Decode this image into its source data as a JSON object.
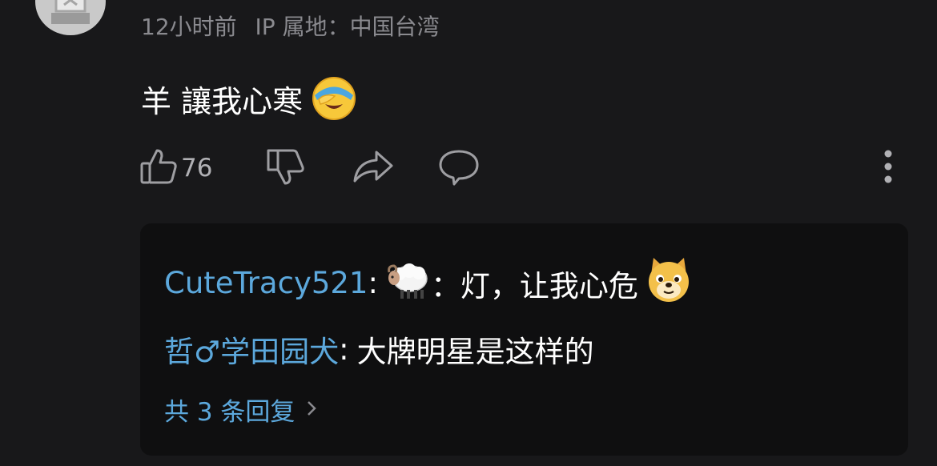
{
  "comment": {
    "time": "12小时前",
    "ip_location": "IP 属地：中国台湾",
    "text": "羊 讓我心寒",
    "like_count": "76",
    "icons": {
      "like": "thumbs-up-icon",
      "dislike": "thumbs-down-icon",
      "share": "share-icon",
      "reply": "comment-icon",
      "more": "more-vertical-icon",
      "emoji": "face-with-hand-emoji"
    }
  },
  "replies": {
    "items": [
      {
        "user": "CuteTracy521",
        "colon": ":",
        "emoji": "sheep-emoji",
        "text": "：灯，让我心危",
        "trailing_emoji": "doge-emoji"
      },
      {
        "user": "哲♂学田园犬",
        "colon": ":",
        "text": "大牌明星是这样的"
      }
    ],
    "more_label": "共 3 条回复"
  },
  "colors": {
    "background": "#18181a",
    "reply_panel": "#0f0f10",
    "username": "#5ca8dc",
    "meta_text": "#8a8a8f"
  }
}
